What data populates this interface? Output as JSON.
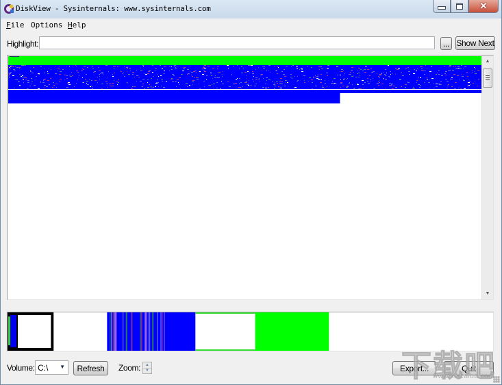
{
  "window": {
    "title": "DiskView - Sysinternals: www.sysinternals.com",
    "controls": {
      "minimize": "minimize",
      "maximize": "maximize",
      "close": "close"
    }
  },
  "menu": [
    {
      "label": "File",
      "accel": "F",
      "rest": "ile"
    },
    {
      "label": "Options",
      "accel": "",
      "rest": "Options"
    },
    {
      "label": "Help",
      "accel": "H",
      "rest": "elp"
    }
  ],
  "highlight": {
    "label": "Highlight:",
    "value": "",
    "browse_label": "...",
    "show_next_label": "Show Next"
  },
  "colors": {
    "free_space": "#ffffff",
    "used_cluster": "#0000ff",
    "metafile": "#00ff00",
    "fragmented": "#cc0066",
    "system": "#000000"
  },
  "cluster_map": {
    "rows": [
      {
        "color": "#00ff00",
        "fill": 1.0
      },
      {
        "color": "#0000ff",
        "fill": 1.0,
        "noisy": true
      },
      {
        "color": "#0000ff",
        "fill": 1.0,
        "noisy": true
      },
      {
        "color": "#0000ff",
        "fill": 1.0,
        "noisy": true,
        "specks": true
      },
      {
        "color": "#0000ff",
        "fill": 1.0
      },
      {
        "color": "#0000ff",
        "fill": 0.7
      }
    ]
  },
  "overview_map": {
    "segments": [
      {
        "type": "system",
        "from": 0.0,
        "to": 0.095
      },
      {
        "type": "free",
        "from": 0.095,
        "to": 0.205
      },
      {
        "type": "used-striped",
        "from": 0.205,
        "to": 0.387
      },
      {
        "type": "free-green-border",
        "from": 0.387,
        "to": 0.51
      },
      {
        "type": "metafile",
        "from": 0.51,
        "to": 0.662
      },
      {
        "type": "free",
        "from": 0.662,
        "to": 1.0
      }
    ]
  },
  "footer": {
    "volume_label": "Volume:",
    "volume_value": "C:\\",
    "refresh_label": "Refresh",
    "zoom_label": "Zoom:",
    "export_label": "Export...",
    "quit_label": "Quit"
  },
  "watermark": {
    "text": "下载吧",
    "url": "www.xiazaiba.com"
  }
}
